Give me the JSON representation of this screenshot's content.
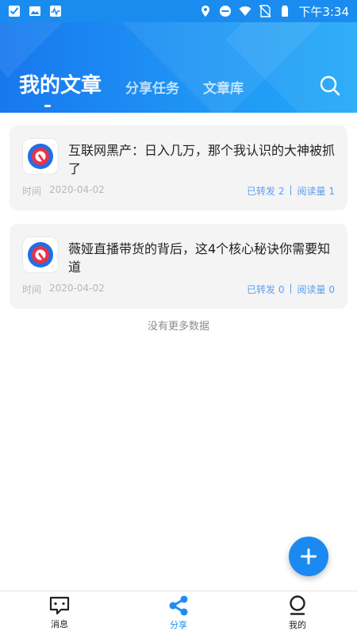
{
  "status_bar": {
    "time": "下午3:34"
  },
  "header": {
    "tabs": [
      {
        "label": "我的文章",
        "active": true
      },
      {
        "label": "分享任务",
        "active": false
      },
      {
        "label": "文章库",
        "active": false
      }
    ]
  },
  "articles": [
    {
      "title": "互联网黑产：日入几万，那个我认识的大神被抓了",
      "time_label": "时间",
      "date": "2020-04-02",
      "shared": "已转发 2",
      "reads": "阅读量 1"
    },
    {
      "title": "薇娅直播带货的背后，这4个核心秘诀你需要知道",
      "time_label": "时间",
      "date": "2020-04-02",
      "shared": "已转发 0",
      "reads": "阅读量 0"
    }
  ],
  "list_footer": "没有更多数据",
  "bottom_nav": [
    {
      "label": "消息",
      "icon": "message-icon",
      "active": false
    },
    {
      "label": "分享",
      "icon": "share-icon",
      "active": true
    },
    {
      "label": "我的",
      "icon": "profile-icon",
      "active": false
    }
  ],
  "colors": {
    "primary": "#1f8df0",
    "header_start": "#1778ee",
    "header_end": "#21a8f7",
    "stat_text": "#5a9ef0"
  }
}
